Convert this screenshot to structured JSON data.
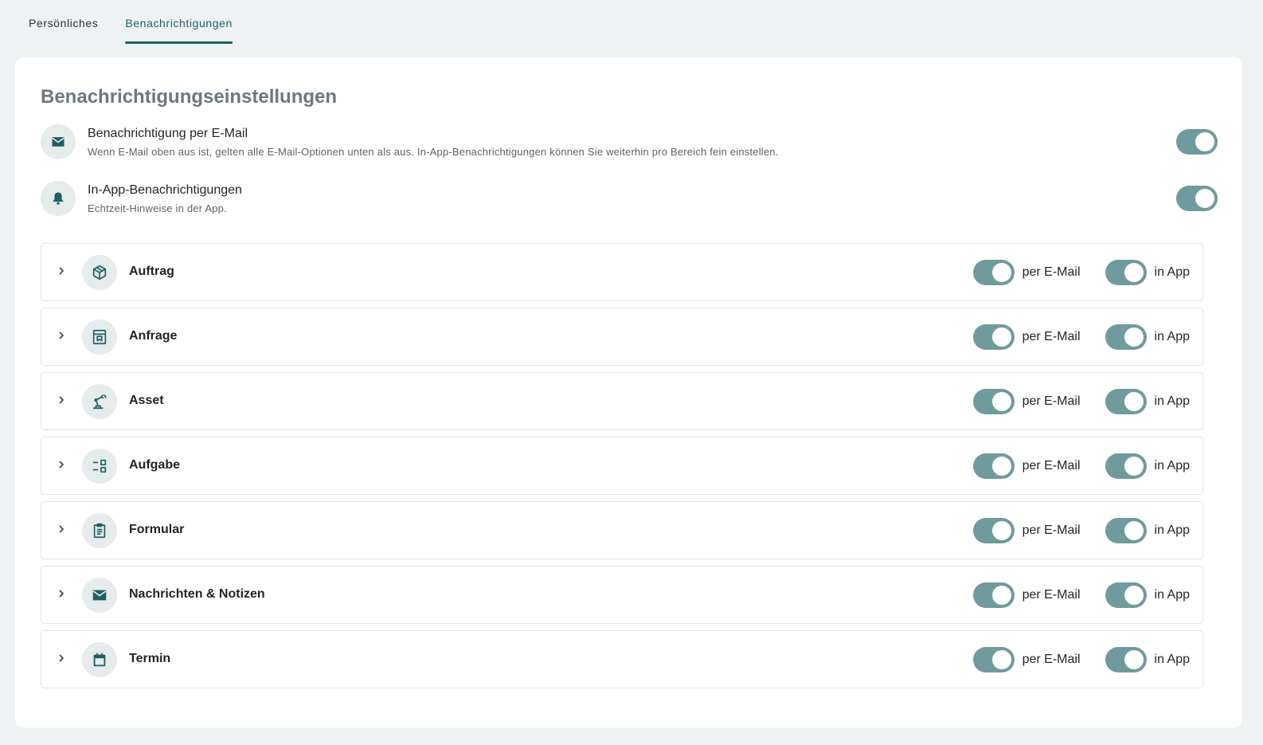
{
  "tabs": [
    {
      "label": "Persönliches",
      "active": false
    },
    {
      "label": "Benachrichtigungen",
      "active": true
    }
  ],
  "card": {
    "title": "Benachrichtigungseinstellungen"
  },
  "global": {
    "email": {
      "title": "Benachrichtigung per E-Mail",
      "description": "Wenn E-Mail oben aus ist, gelten alle E-Mail-Optionen unten als aus. In-App-Benachrichtigungen können Sie weiterhin pro Bereich fein einstellen.",
      "icon": "mail-icon",
      "enabled": true
    },
    "inapp": {
      "title": "In-App-Benachrichtigungen",
      "description": "Echtzeit-Hinweise in der App.",
      "icon": "bell-icon",
      "enabled": true
    }
  },
  "labels": {
    "email": "per E-Mail",
    "inapp": "in App"
  },
  "sections": [
    {
      "label": "Auftrag",
      "icon": "box-icon",
      "email": true,
      "inapp": true
    },
    {
      "label": "Anfrage",
      "icon": "request-icon",
      "email": true,
      "inapp": true
    },
    {
      "label": "Asset",
      "icon": "robot-arm-icon",
      "email": true,
      "inapp": true
    },
    {
      "label": "Aufgabe",
      "icon": "task-icon",
      "email": true,
      "inapp": true
    },
    {
      "label": "Formular",
      "icon": "clipboard-icon",
      "email": true,
      "inapp": true
    },
    {
      "label": "Nachrichten & Notizen",
      "icon": "mail-icon",
      "email": true,
      "inapp": true
    },
    {
      "label": "Termin",
      "icon": "calendar-icon",
      "email": true,
      "inapp": true
    }
  ],
  "colors": {
    "accent": "#1e5f63",
    "toggle_on": "#6f9b9e",
    "background": "#eef2f3"
  }
}
